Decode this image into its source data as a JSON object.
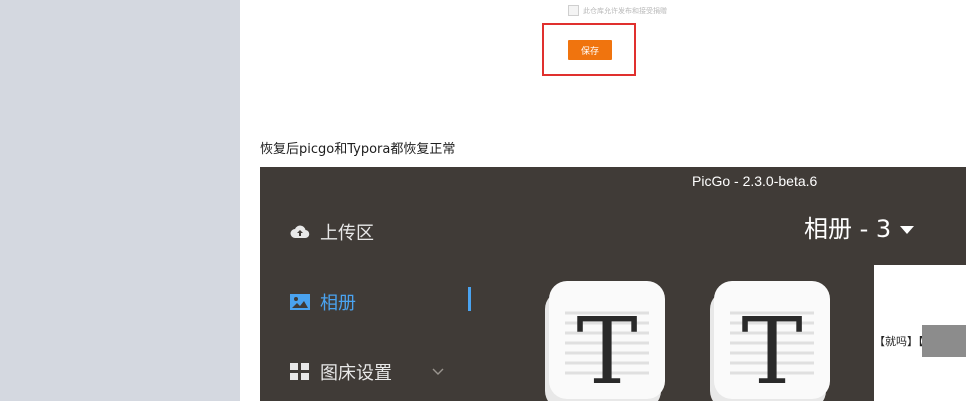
{
  "consent": {
    "checkbox_label": "此仓库允许发布和接受捐赠"
  },
  "save_button": {
    "label": "保存"
  },
  "caption": "恢复后picgo和Typora都恢复正常",
  "picgo": {
    "window_title": "PicGo - 2.3.0-beta.6",
    "nav": [
      {
        "label": "上传区",
        "icon": "cloud-upload-icon"
      },
      {
        "label": "相册",
        "icon": "image-icon",
        "active": true
      },
      {
        "label": "图床设置",
        "icon": "grid-icon"
      }
    ],
    "album_title": "相册 - 3",
    "thumbnails": [
      {
        "letter": "T",
        "icon": "typora-icon"
      },
      {
        "letter": "T",
        "icon": "typora-icon"
      }
    ],
    "partial_thumbnail_text": "【就吗】【输入",
    "active_color": "#4aa3f0",
    "save_color": "#f0740e",
    "highlight_color": "#e0302e"
  }
}
